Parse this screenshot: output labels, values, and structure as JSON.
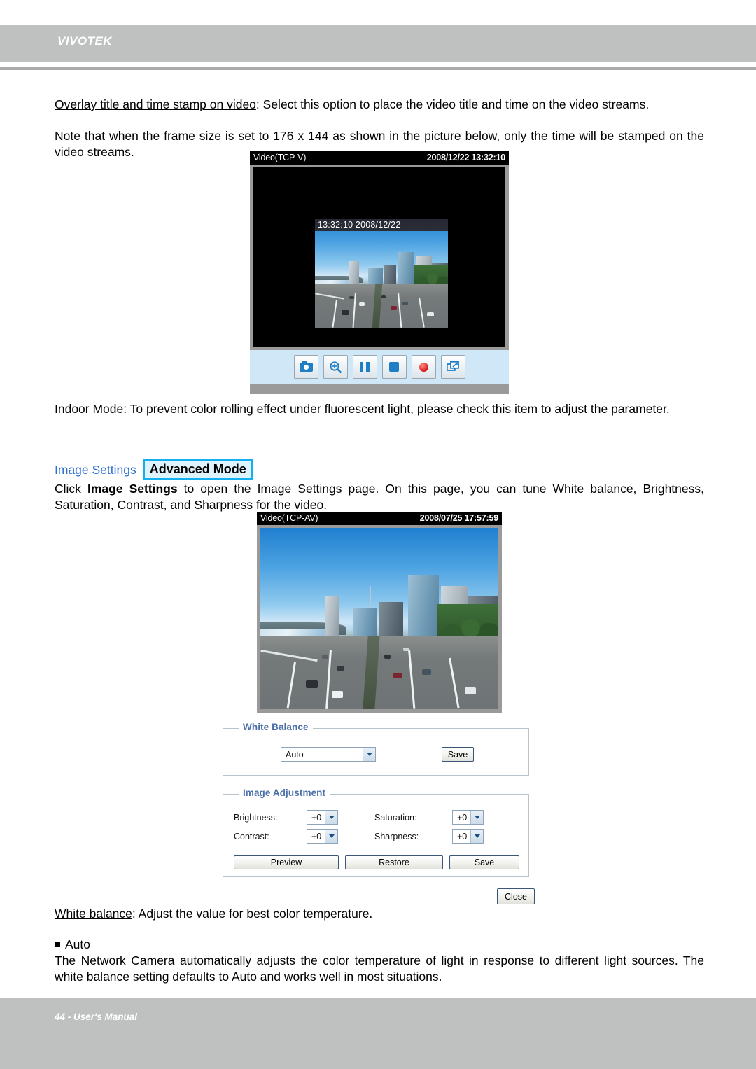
{
  "header": {
    "brand": "VIVOTEK"
  },
  "body": {
    "overlay_term": "Overlay title and time stamp on video",
    "overlay_desc": ": Select this option to place the video title and time on the video streams.",
    "note_text": "Note that when the frame size is set to 176 x 144 as shown in the picture below, only the time will be stamped on the video streams.",
    "indoor_term": "Indoor Mode",
    "indoor_desc": ": To prevent color rolling effect under fluorescent light, please check this item to adjust the parameter.",
    "link_image_settings": "Image Settings",
    "badge_advanced_mode": "Advanced Mode",
    "click_prefix": "Click ",
    "click_bold": "Image Settings",
    "click_suffix": " to open the Image Settings page. On this page, you can tune White balance, Brightness, Saturation, Contrast, and Sharpness for the video.",
    "wb_term": "White balance",
    "wb_desc": ": Adjust the value for best color temperature.",
    "auto_bullet": "Auto",
    "auto_desc": "The Network Camera automatically adjusts the color temperature of light in response to different light sources. The white balance setting defaults to Auto and works well in most situations."
  },
  "player_small": {
    "title": "Video(TCP-V)",
    "timestamp": "2008/12/22 13:32:10",
    "overlay_timestamp": "13:32:10 2008/12/22",
    "toolbar": [
      {
        "name": "snapshot-icon",
        "label": "Snapshot"
      },
      {
        "name": "digital-zoom-icon",
        "label": "Digital Zoom"
      },
      {
        "name": "pause-icon",
        "label": "Pause"
      },
      {
        "name": "stop-icon",
        "label": "Stop"
      },
      {
        "name": "record-icon",
        "label": "Record"
      },
      {
        "name": "fullscreen-icon",
        "label": "Full Screen"
      }
    ]
  },
  "player_large": {
    "title": "Video(TCP-AV)",
    "timestamp": "2008/07/25 17:57:59"
  },
  "white_balance_panel": {
    "legend": "White Balance",
    "select_value": "Auto",
    "save_label": "Save"
  },
  "image_adjustment_panel": {
    "legend": "Image Adjustment",
    "fields": [
      {
        "label": "Brightness:",
        "value": "+0"
      },
      {
        "label": "Contrast:",
        "value": "+0"
      },
      {
        "label": "Saturation:",
        "value": "+0"
      },
      {
        "label": "Sharpness:",
        "value": "+0"
      }
    ],
    "preview_label": "Preview",
    "restore_label": "Restore",
    "save_label": "Save"
  },
  "close_button": {
    "label": "Close"
  },
  "footer": {
    "note": "44 - User's Manual"
  },
  "colors": {
    "header_gray": "#bfc1c1",
    "link_blue": "#2b6ed0",
    "badge_border": "#13b0ef",
    "badge_fill": "#ddf3fd",
    "legend_blue": "#4b6fa8",
    "toolbar_blue": "#cfe7f7",
    "icon_blue": "#1f7ec4",
    "record_red": "#d81818"
  }
}
